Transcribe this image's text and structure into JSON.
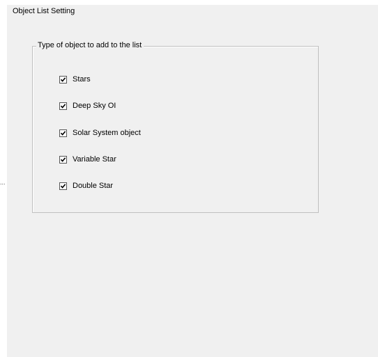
{
  "window": {
    "title": "Object List Setting"
  },
  "group": {
    "label": "Type of object to add to the list",
    "options": [
      {
        "label": "Stars",
        "checked": true
      },
      {
        "label": "Deep Sky OI",
        "checked": true
      },
      {
        "label": "Solar System object",
        "checked": true
      },
      {
        "label": "Variable Star",
        "checked": true
      },
      {
        "label": "Double Star",
        "checked": true
      }
    ]
  },
  "edge_marker": "..."
}
